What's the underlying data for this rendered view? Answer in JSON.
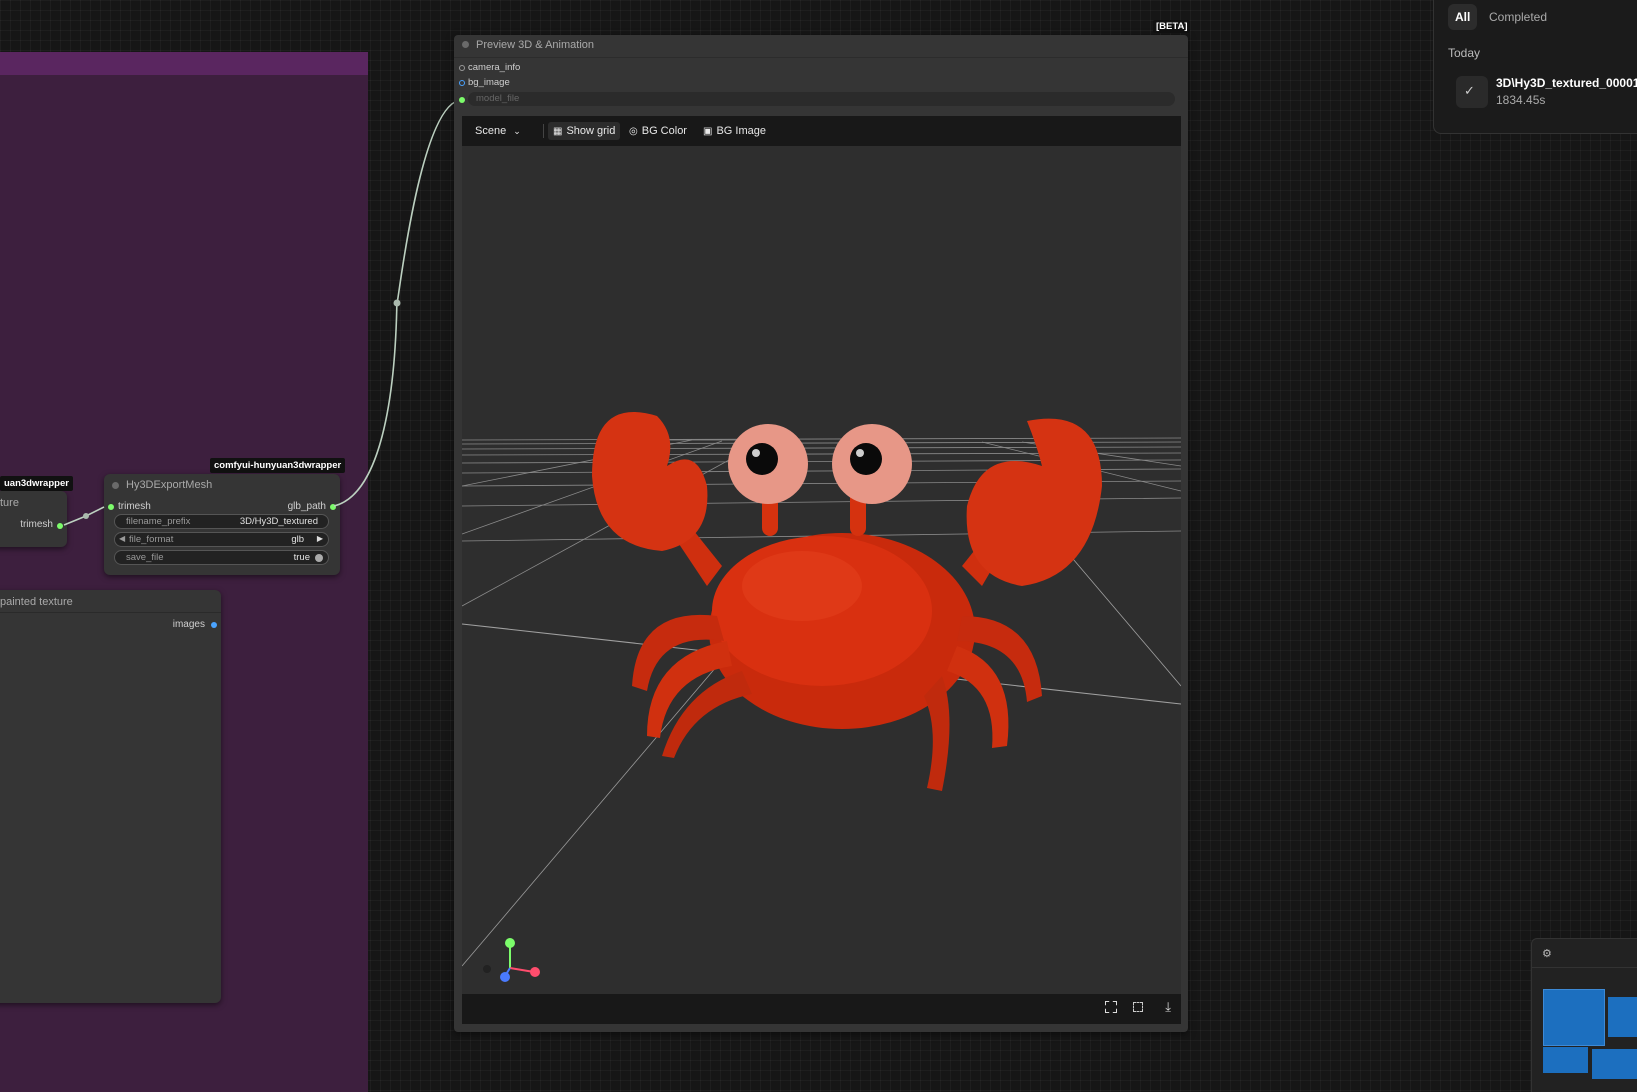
{
  "beta_badge": "[BETA]",
  "queue": {
    "tabs": [
      {
        "label": "All",
        "active": true
      },
      {
        "label": "Completed",
        "active": false
      }
    ],
    "section": "Today",
    "items": [
      {
        "title": "3D\\Hy3D_textured_00001",
        "duration": "1834.45s"
      }
    ]
  },
  "left_nodes": {
    "wrapper_badge": "uan3dwrapper",
    "partial_title": "ture",
    "output_slot": "trimesh",
    "painted_title": "painted texture",
    "painted_output": "images"
  },
  "export_node": {
    "badge": "comfyui-hunyuan3dwrapper",
    "title": "Hy3DExportMesh",
    "input": "trimesh",
    "output": "glb_path",
    "widgets": [
      {
        "label": "filename_prefix",
        "value": "3D/Hy3D_textured"
      },
      {
        "label": "file_format",
        "value": "glb"
      },
      {
        "label": "save_file",
        "value": "true"
      }
    ]
  },
  "preview_node": {
    "title": "Preview 3D & Animation",
    "inputs": [
      "camera_info",
      "bg_image",
      "model_file"
    ],
    "toolbar": {
      "scene": "Scene",
      "show_grid": "Show grid",
      "bg_color": "BG Color",
      "bg_image": "BG Image"
    }
  },
  "colors": {
    "group_bg": "#3d1f3e",
    "group_header": "#5a2660",
    "node_bg": "#353535",
    "crab": "#d93010",
    "accent_green": "#7cfc6b",
    "accent_blue": "#4aa3ff"
  }
}
